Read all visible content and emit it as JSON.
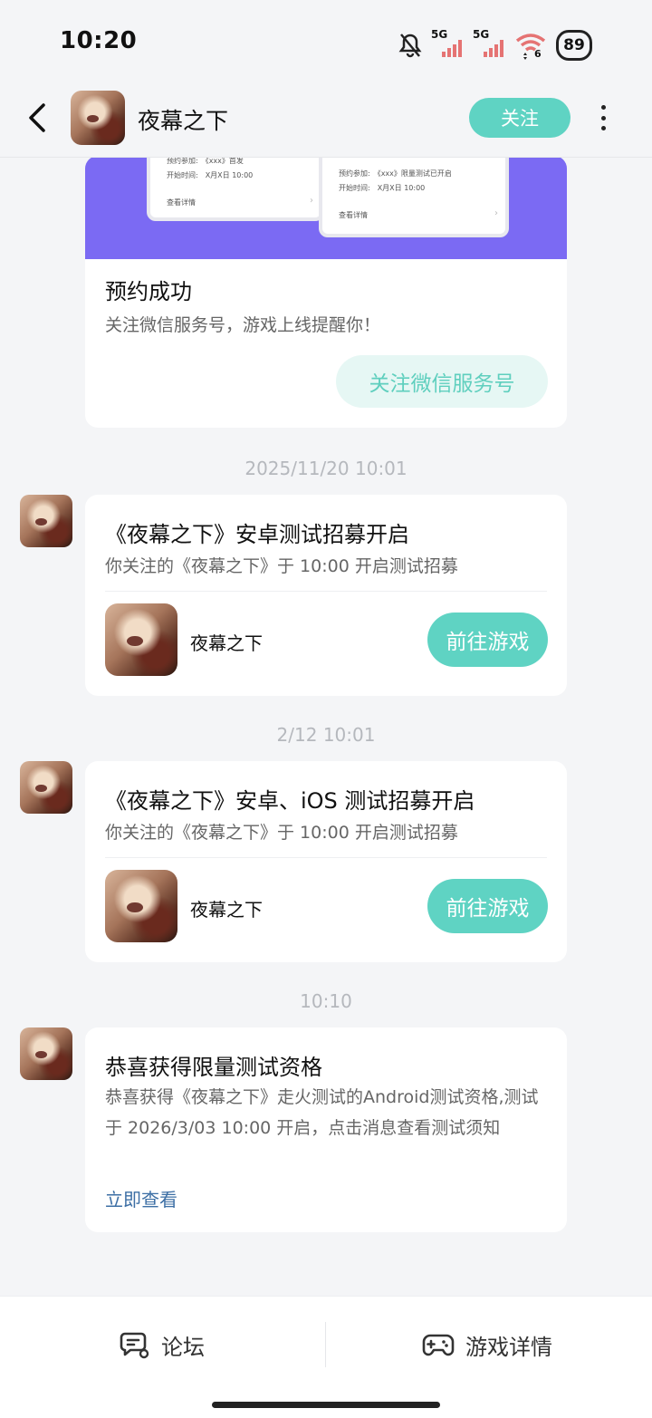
{
  "status_bar": {
    "time": "10:20",
    "signal_1_label": "5G",
    "signal_2_label": "5G",
    "wifi_badge": "6",
    "battery": "89",
    "icons": [
      "mute-icon",
      "signal-icon",
      "signal-icon",
      "wifi-icon",
      "battery-icon"
    ]
  },
  "header": {
    "title": "夜幕之下",
    "follow_label": "关注",
    "icons": [
      "back-icon",
      "more-icon"
    ]
  },
  "banner_mock": {
    "card_a": {
      "row1": "预约参加:　《xxx》首发",
      "row2": "开始时间:　X月X日 10:00",
      "link": "查看详情"
    },
    "card_b": {
      "row1": "预约参加:　《xxx》限量测试已开启",
      "row2": "开始时间:　X月X日 10:00",
      "link": "查看详情"
    }
  },
  "reservation": {
    "title": "预约成功",
    "subtitle": "关注微信服务号，游戏上线提醒你！",
    "button": "关注微信服务号"
  },
  "messages": [
    {
      "timestamp": "2025/11/20  10:01",
      "title": "《夜幕之下》安卓测试招募开启",
      "subtitle": "你关注的《夜幕之下》于 10:00 开启测试招募",
      "game_name": "夜幕之下",
      "button": "前往游戏"
    },
    {
      "timestamp": "2/12  10:01",
      "title": "《夜幕之下》安卓、iOS 测试招募开启",
      "subtitle": "你关注的《夜幕之下》于 10:00 开启测试招募",
      "game_name": "夜幕之下",
      "button": "前往游戏"
    },
    {
      "timestamp": "10:10",
      "title": "恭喜获得限量测试资格",
      "body": "恭喜获得《夜幕之下》走火测试的Android测试资格,测试于 2026/3/03 10:00 开启，点击消息查看测试须知",
      "link": "立即查看"
    }
  ],
  "bottom_bar": {
    "tabs": [
      {
        "label": "论坛",
        "icon": "forum-icon"
      },
      {
        "label": "游戏详情",
        "icon": "gamepad-icon"
      }
    ]
  },
  "colors": {
    "accent": "#5fd3c3",
    "banner": "#7b6af3",
    "link": "#3d6fa5",
    "background": "#f4f5f7"
  }
}
